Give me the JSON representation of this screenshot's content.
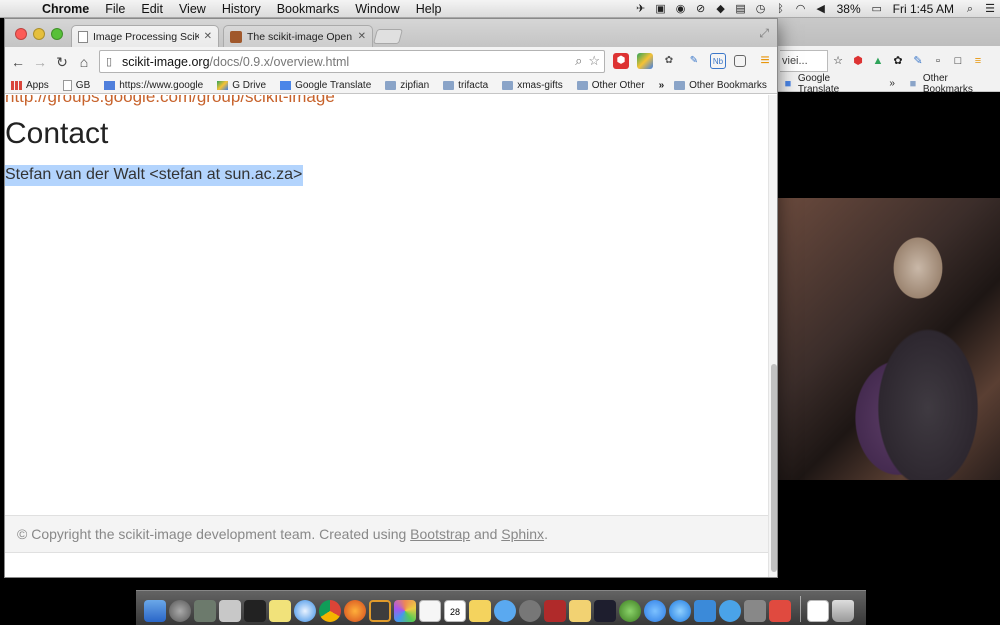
{
  "menubar": {
    "app": "Chrome",
    "items": [
      "File",
      "Edit",
      "View",
      "History",
      "Bookmarks",
      "Window",
      "Help"
    ],
    "battery": "38%",
    "clock": "Fri 1:45 AM"
  },
  "tabs": [
    {
      "title": "Image Processing SciKit —",
      "active": true
    },
    {
      "title": "The scikit-image Open Sou",
      "active": false
    }
  ],
  "omnibox": {
    "host": "scikit-image.org",
    "path": "/docs/0.9.x/overview.html"
  },
  "bookmarks": {
    "items": [
      "Apps",
      "GB",
      "https://www.google",
      "G Drive",
      "Google Translate",
      "zipfian",
      "trifacta",
      "xmas-gifts",
      "Other Other"
    ],
    "chevron": "»",
    "other": "Other Bookmarks"
  },
  "bg_browser": {
    "url_fragment": "viei...",
    "bookmarks": [
      "Google Translate",
      "Other Bookmarks"
    ]
  },
  "page": {
    "cut_link": "http://groups.google.com/group/scikit-image",
    "heading": "Contact",
    "contact": "Stefan van der Walt <stefan at sun.ac.za>",
    "footer": {
      "prefix": "© Copyright the scikit-image development team. Created using ",
      "link1": "Bootstrap",
      "middle": " and ",
      "link2": "Sphinx",
      "suffix": "."
    }
  },
  "dock": {
    "calendar_day": "28"
  },
  "colors": {
    "link": "#c7622b",
    "selection": "#b3d4fd"
  }
}
